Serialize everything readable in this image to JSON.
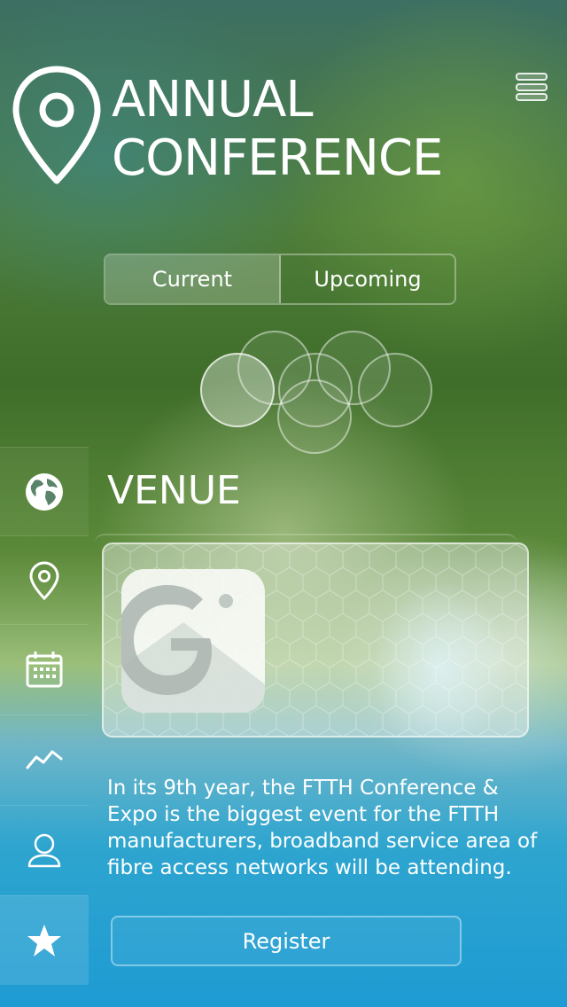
{
  "header": {
    "title_line1": "ANNUAL",
    "title_line2": "CONFERENCE",
    "logo_icon": "location-pin-icon",
    "menu_icon": "hamburger-menu-icon"
  },
  "tabs": [
    {
      "label": "Current",
      "active": true
    },
    {
      "label": "Upcoming",
      "active": false
    }
  ],
  "carousel": {
    "count": 6,
    "active_index": 0
  },
  "sidebar": {
    "items": [
      {
        "icon": "globe-icon",
        "active": true
      },
      {
        "icon": "location-pin-icon",
        "active": false
      },
      {
        "icon": "calendar-icon",
        "active": false
      },
      {
        "icon": "chart-line-icon",
        "active": false
      },
      {
        "icon": "user-icon",
        "active": false
      },
      {
        "icon": "star-icon",
        "active": false
      }
    ]
  },
  "venue": {
    "title": "VENUE",
    "map_icon": "google-maps-icon",
    "description": "In its 9th year, the FTTH Conference & Expo is the biggest event for the FTTH manufacturers, broadband service area of fibre access networks will be attending."
  },
  "actions": {
    "register_label": "Register"
  },
  "colors": {
    "primary_text": "#ffffff",
    "water_blue": "#1e9bd3",
    "foliage_green": "#4f7d3a"
  }
}
